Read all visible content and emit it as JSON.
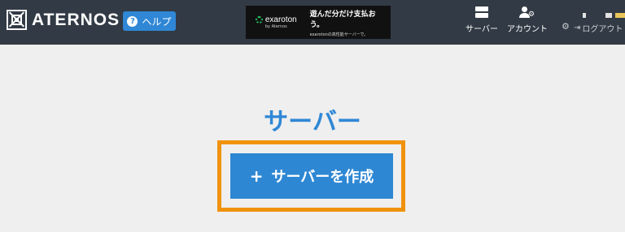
{
  "header": {
    "brand": "ATERNOS",
    "help_label": "ヘルプ",
    "help_icon": "?",
    "nav": {
      "servers_label": "サーバー",
      "account_label": "アカウント",
      "logout_label": "ログアウト"
    }
  },
  "ad": {
    "brand": "exaroton",
    "brand_sub": "by Aternos",
    "headline": "遊んだ分だけ支払おう。",
    "subline": "exarotonの高性能サーバーで。"
  },
  "main": {
    "title": "サーバー",
    "create_button_label": "サーバーを作成",
    "create_button_icon": "+"
  },
  "colors": {
    "header_bg": "#323a45",
    "accent_blue": "#2f87d6",
    "highlight_orange": "#f0920e",
    "page_bg": "#efefef"
  }
}
